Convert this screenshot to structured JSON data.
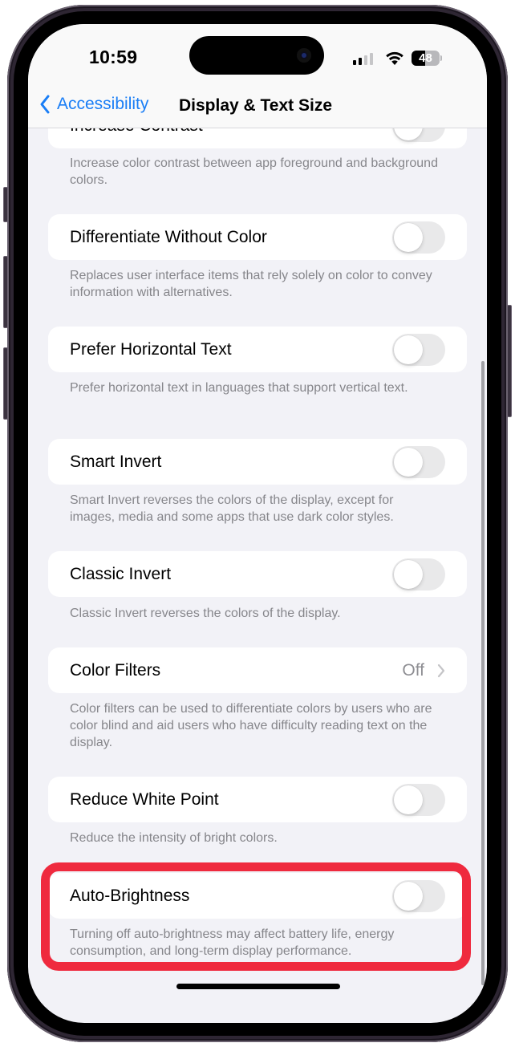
{
  "status_bar": {
    "time": "10:59",
    "battery_percent": "48",
    "battery_level": 0.48,
    "signal_bars_active": 2,
    "signal_bars_total": 4
  },
  "nav": {
    "back_label": "Accessibility",
    "title": "Display & Text Size"
  },
  "settings": [
    {
      "label": "Increase Contrast",
      "type": "toggle",
      "on": false,
      "footer": "Increase color contrast between app foreground and background colors."
    },
    {
      "label": "Differentiate Without Color",
      "type": "toggle",
      "on": false,
      "footer": "Replaces user interface items that rely solely on color to convey information with alternatives."
    },
    {
      "label": "Prefer Horizontal Text",
      "type": "toggle",
      "on": false,
      "footer": "Prefer horizontal text in languages that support vertical text."
    },
    {
      "label": "Smart Invert",
      "type": "toggle",
      "on": false,
      "footer": "Smart Invert reverses the colors of the display, except for images, media and some apps that use dark color styles."
    },
    {
      "label": "Classic Invert",
      "type": "toggle",
      "on": false,
      "footer": "Classic Invert reverses the colors of the display."
    },
    {
      "label": "Color Filters",
      "type": "disclosure",
      "value": "Off",
      "footer": "Color filters can be used to differentiate colors by users who are color blind and aid users who have difficulty reading text on the display."
    },
    {
      "label": "Reduce White Point",
      "type": "toggle",
      "on": false,
      "footer": "Reduce the intensity of bright colors."
    },
    {
      "label": "Auto-Brightness",
      "type": "toggle",
      "on": false,
      "footer": "Turning off auto-brightness may affect battery life, energy consumption, and long-term display performance.",
      "highlighted": true
    }
  ],
  "colors": {
    "accent": "#1a7ef6",
    "highlight": "#ef2a3e",
    "toggle_off": "#e9e9ea",
    "background": "#f2f2f7"
  }
}
